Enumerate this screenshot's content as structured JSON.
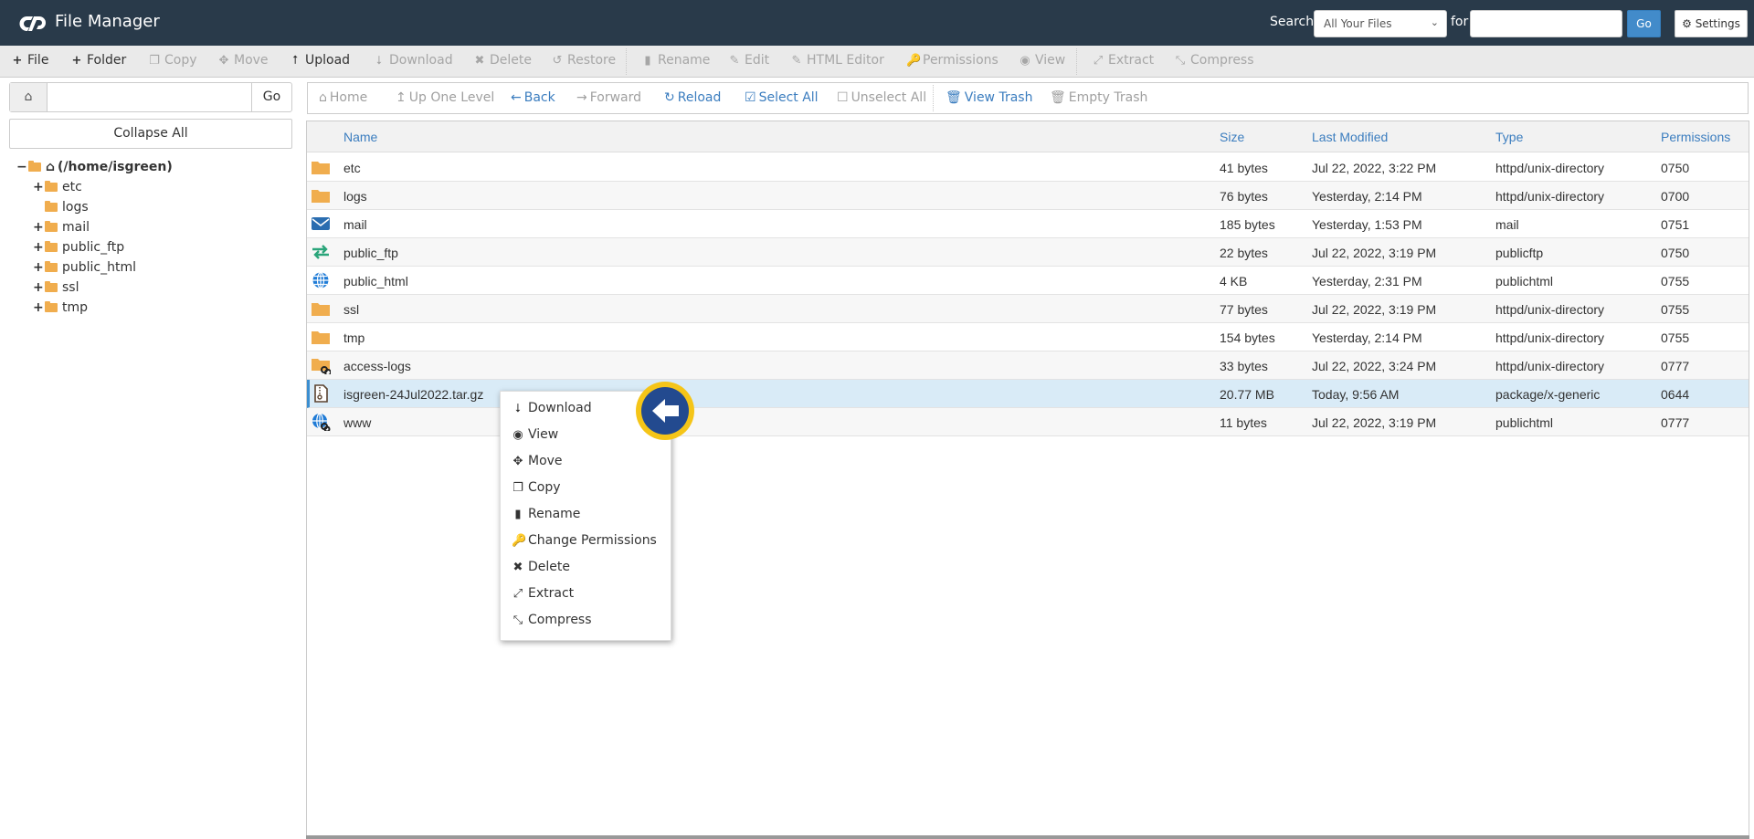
{
  "app": {
    "title": "File Manager",
    "logo_icon": "cpanel-logo-icon"
  },
  "header_search": {
    "label": "Search",
    "scope_selected": "All Your Files",
    "for_label": "for",
    "query_value": "",
    "go_label": "Go",
    "settings_label": "Settings",
    "settings_icon": "gear-icon"
  },
  "toolbar": {
    "items": [
      {
        "label": "File",
        "icon": "plus-icon",
        "enabled": true
      },
      {
        "label": "Folder",
        "icon": "plus-icon",
        "enabled": true
      },
      {
        "label": "Copy",
        "icon": "copy-icon",
        "enabled": false
      },
      {
        "label": "Move",
        "icon": "move-icon",
        "enabled": false
      },
      {
        "label": "Upload",
        "icon": "upload-icon",
        "enabled": true
      },
      {
        "label": "Download",
        "icon": "download-icon",
        "enabled": false
      },
      {
        "label": "Delete",
        "icon": "delete-icon",
        "enabled": false
      },
      {
        "label": "Restore",
        "icon": "restore-icon",
        "enabled": false
      },
      {
        "label": "Rename",
        "icon": "file-icon",
        "enabled": false
      },
      {
        "label": "Edit",
        "icon": "pencil-icon",
        "enabled": false
      },
      {
        "label": "HTML Editor",
        "icon": "edit-square-icon",
        "enabled": false
      },
      {
        "label": "Permissions",
        "icon": "key-icon",
        "enabled": false
      },
      {
        "label": "View",
        "icon": "eye-icon",
        "enabled": false
      },
      {
        "label": "Extract",
        "icon": "expand-icon",
        "enabled": false
      },
      {
        "label": "Compress",
        "icon": "compress-icon",
        "enabled": false
      }
    ]
  },
  "sidebar": {
    "path_value": "",
    "go_label": "Go",
    "collapse_label": "Collapse All",
    "root_label": "(/home/isgreen)",
    "tree": [
      {
        "label": "etc",
        "expandable": true
      },
      {
        "label": "logs",
        "expandable": false
      },
      {
        "label": "mail",
        "expandable": true
      },
      {
        "label": "public_ftp",
        "expandable": true
      },
      {
        "label": "public_html",
        "expandable": true
      },
      {
        "label": "ssl",
        "expandable": true
      },
      {
        "label": "tmp",
        "expandable": true
      }
    ]
  },
  "navbar": {
    "items": [
      {
        "label": "Home",
        "icon": "home-icon",
        "enabled": false
      },
      {
        "label": "Up One Level",
        "icon": "level-up-icon",
        "enabled": false
      },
      {
        "label": "Back",
        "icon": "arrow-left-icon",
        "enabled": true
      },
      {
        "label": "Forward",
        "icon": "arrow-right-icon",
        "enabled": false
      },
      {
        "label": "Reload",
        "icon": "refresh-icon",
        "enabled": true
      },
      {
        "label": "Select All",
        "icon": "checkbox-checked-icon",
        "enabled": true
      },
      {
        "label": "Unselect All",
        "icon": "checkbox-empty-icon",
        "enabled": false
      },
      {
        "label": "View Trash",
        "icon": "trash-icon",
        "enabled": true
      },
      {
        "label": "Empty Trash",
        "icon": "trash-icon",
        "enabled": false
      }
    ]
  },
  "table": {
    "columns": [
      "Name",
      "Size",
      "Last Modified",
      "Type",
      "Permissions"
    ],
    "rows": [
      {
        "icon": "folder-icon",
        "name": "etc",
        "size": "41 bytes",
        "modified": "Jul 22, 2022, 3:22 PM",
        "type": "httpd/unix-directory",
        "perms": "0750"
      },
      {
        "icon": "folder-icon",
        "name": "logs",
        "size": "76 bytes",
        "modified": "Yesterday, 2:14 PM",
        "type": "httpd/unix-directory",
        "perms": "0700"
      },
      {
        "icon": "mail-icon",
        "name": "mail",
        "size": "185 bytes",
        "modified": "Yesterday, 1:53 PM",
        "type": "mail",
        "perms": "0751"
      },
      {
        "icon": "transfer-icon",
        "name": "public_ftp",
        "size": "22 bytes",
        "modified": "Jul 22, 2022, 3:19 PM",
        "type": "publicftp",
        "perms": "0750"
      },
      {
        "icon": "globe-icon",
        "name": "public_html",
        "size": "4 KB",
        "modified": "Yesterday, 2:31 PM",
        "type": "publichtml",
        "perms": "0755"
      },
      {
        "icon": "folder-icon",
        "name": "ssl",
        "size": "77 bytes",
        "modified": "Jul 22, 2022, 3:19 PM",
        "type": "httpd/unix-directory",
        "perms": "0755"
      },
      {
        "icon": "folder-icon",
        "name": "tmp",
        "size": "154 bytes",
        "modified": "Yesterday, 2:14 PM",
        "type": "httpd/unix-directory",
        "perms": "0755"
      },
      {
        "icon": "folder-link-icon",
        "name": "access-logs",
        "size": "33 bytes",
        "modified": "Jul 22, 2022, 3:24 PM",
        "type": "httpd/unix-directory",
        "perms": "0777"
      },
      {
        "icon": "archive-file-icon",
        "name": "isgreen-24Jul2022.tar.gz",
        "size": "20.77 MB",
        "modified": "Today, 9:56 AM",
        "type": "package/x-generic",
        "perms": "0644",
        "selected": true
      },
      {
        "icon": "globe-link-icon",
        "name": "www",
        "size": "11 bytes",
        "modified": "Jul 22, 2022, 3:19 PM",
        "type": "publichtml",
        "perms": "0777"
      }
    ]
  },
  "context_menu": {
    "items": [
      {
        "label": "Download",
        "icon": "download-icon"
      },
      {
        "label": "View",
        "icon": "eye-icon"
      },
      {
        "label": "Move",
        "icon": "move-icon"
      },
      {
        "label": "Copy",
        "icon": "copy-icon"
      },
      {
        "label": "Rename",
        "icon": "file-icon"
      },
      {
        "label": "Change Permissions",
        "icon": "key-icon"
      },
      {
        "label": "Delete",
        "icon": "delete-icon"
      },
      {
        "label": "Extract",
        "icon": "expand-icon"
      },
      {
        "label": "Compress",
        "icon": "compress-icon"
      }
    ]
  },
  "colors": {
    "header_bg": "#293a4a",
    "link_blue": "#3b7dbf",
    "selected_row": "#d9ebf7",
    "folder": "#f0ad4e",
    "badge_ring": "#f5c518",
    "badge_fill": "#234a8f"
  }
}
